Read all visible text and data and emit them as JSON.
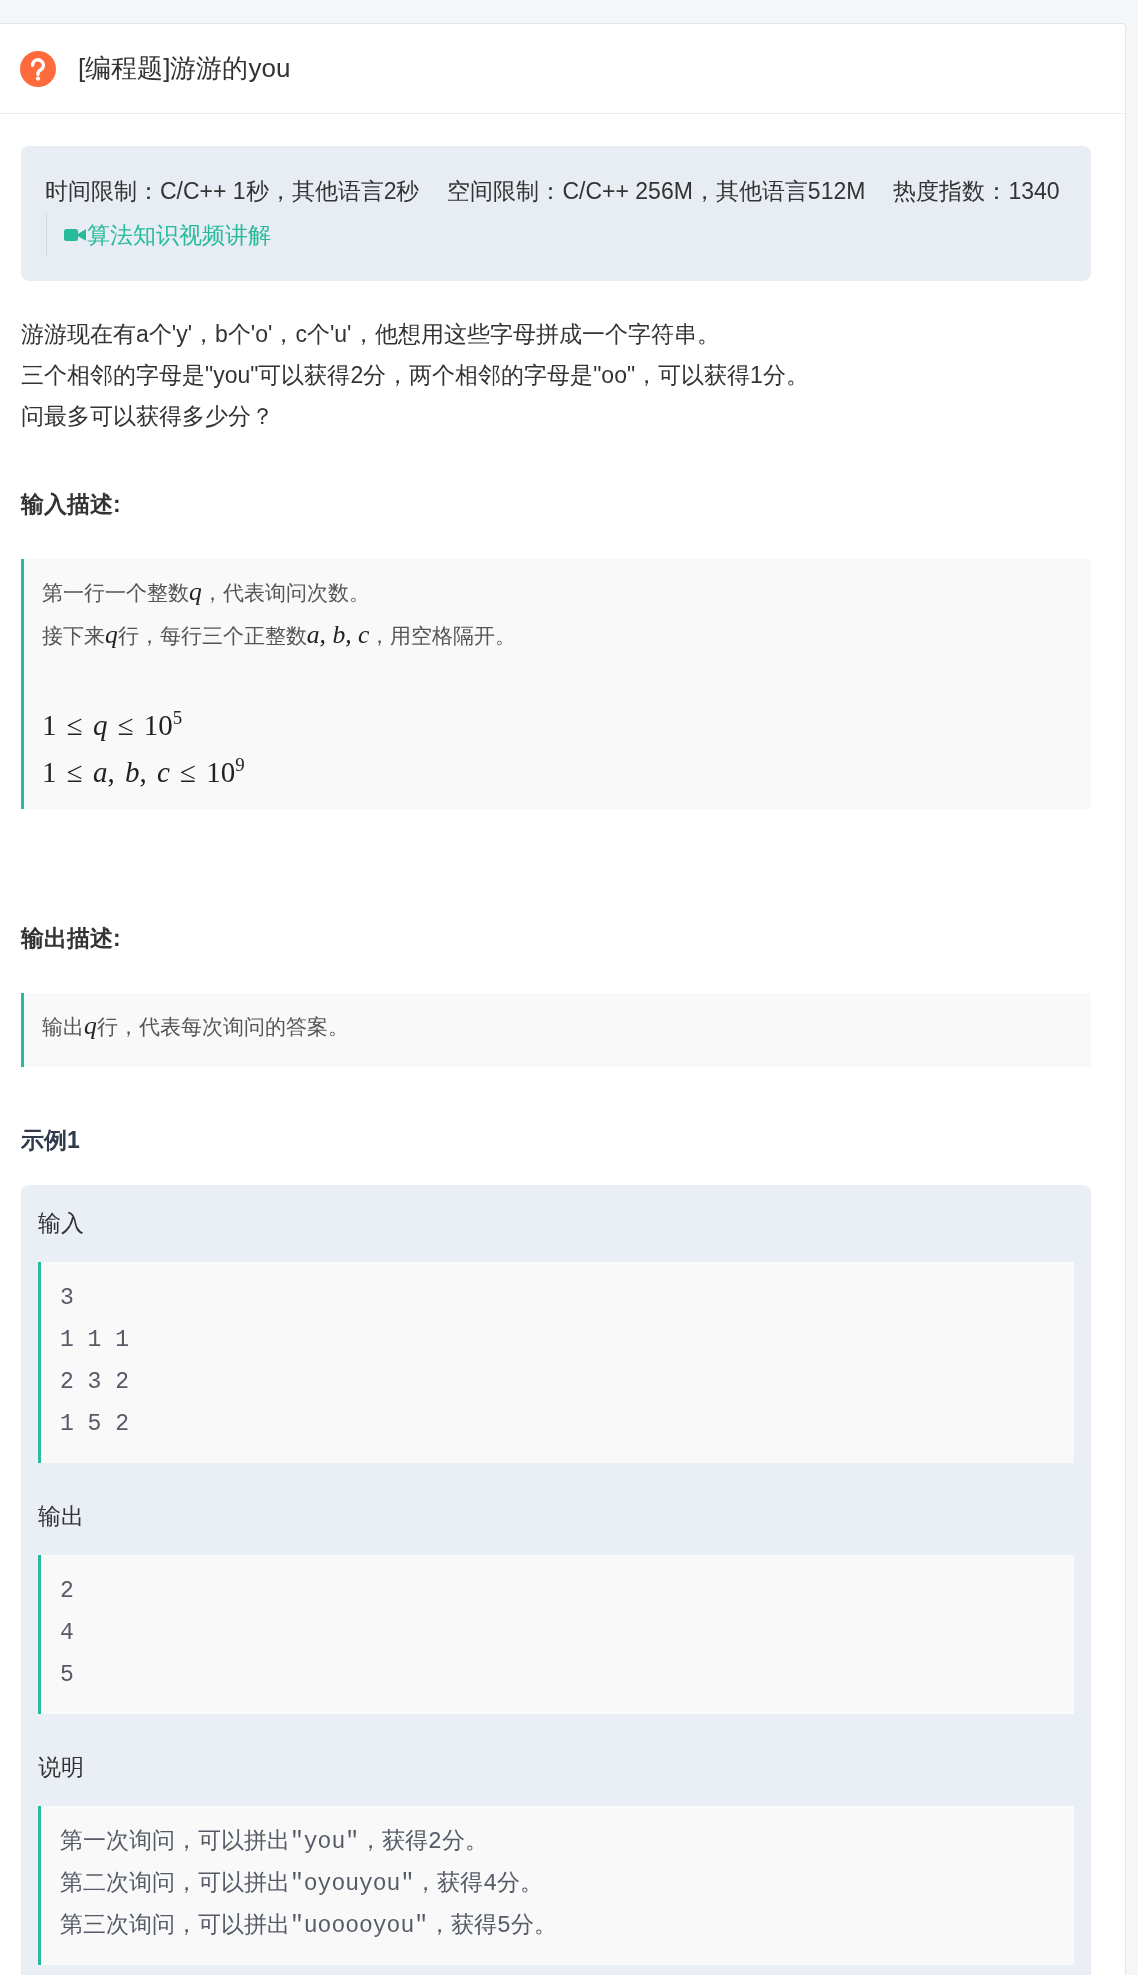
{
  "problem": {
    "title": "[编程题]游游的you"
  },
  "info": {
    "limits": [
      "时间限制：C/C++ 1秒，其他语言2秒",
      "空间限制：C/C++ 256M，其他语言512M",
      "热度指数：1340"
    ],
    "video_link": "算法知识视频讲解"
  },
  "description": [
    "游游现在有a个'y'，b个'o'，c个'u'，他想用这些字母拼成一个字符串。",
    "三个相邻的字母是\"you\"可以获得2分，两个相邻的字母是\"oo\"，可以获得1分。",
    "问最多可以获得多少分？"
  ],
  "input_section": {
    "heading": "输入描述:",
    "lines": [
      [
        {
          "kind": "text",
          "text": "第一行一个整数"
        },
        {
          "kind": "math",
          "text": "q"
        },
        {
          "kind": "text",
          "text": "，代表询问次数。"
        }
      ],
      [
        {
          "kind": "text",
          "text": "接下来"
        },
        {
          "kind": "math",
          "text": "q"
        },
        {
          "kind": "text",
          "text": "行，每行三个正整数"
        },
        {
          "kind": "math",
          "text": "a, b, c"
        },
        {
          "kind": "text",
          "text": "，用空格隔开。"
        }
      ]
    ],
    "constraints": [
      "1 ≤ *q* ≤ 10$^{5}$",
      "1 ≤ *a*, *b*, *c* ≤ 10$^{9}$"
    ]
  },
  "output_section": {
    "heading": "输出描述:",
    "lines": [
      [
        {
          "kind": "text",
          "text": "输出"
        },
        {
          "kind": "math",
          "text": "q"
        },
        {
          "kind": "text",
          "text": "行，代表每次询问的答案。"
        }
      ]
    ]
  },
  "examples": [
    {
      "heading": "示例1",
      "blocks": [
        {
          "label": "输入",
          "lines": [
            "3",
            "1 1 1",
            "2 3 2",
            "1 5 2"
          ]
        },
        {
          "label": "输出",
          "lines": [
            "2",
            "4",
            "5"
          ]
        },
        {
          "label": "说明",
          "lines": [
            "第一次询问，可以拼出\"you\"，获得2分。",
            "第二次询问，可以拼出\"oyouyou\"，获得4分。",
            "第三次询问，可以拼出\"uooooyou\"，获得5分。"
          ]
        }
      ]
    }
  ]
}
